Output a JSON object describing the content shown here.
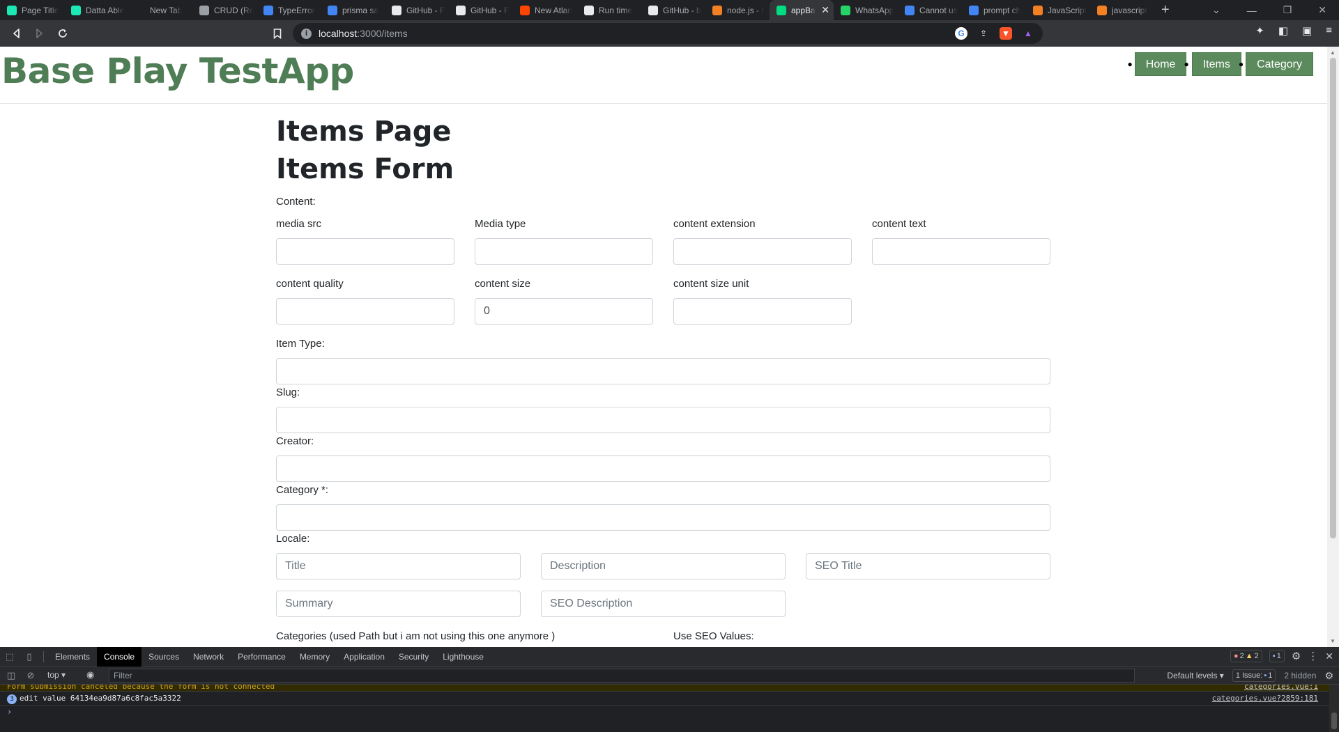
{
  "browser": {
    "tabs": [
      {
        "label": "Page Title",
        "color": "#1de9b6"
      },
      {
        "label": "Datta Able",
        "color": "#1de9b6"
      },
      {
        "label": "New Tab",
        "color": "#202124"
      },
      {
        "label": "CRUD (Re",
        "color": "#9aa0a6"
      },
      {
        "label": "TypeError",
        "color": "#4285f4"
      },
      {
        "label": "prisma sa",
        "color": "#4285f4"
      },
      {
        "label": "GitHub - F",
        "color": "#e8eaed"
      },
      {
        "label": "GitHub - F",
        "color": "#e8eaed"
      },
      {
        "label": "New Atlan",
        "color": "#ff4500"
      },
      {
        "label": "Run time",
        "color": "#e8eaed"
      },
      {
        "label": "GitHub - b",
        "color": "#e8eaed"
      },
      {
        "label": "node.js - I",
        "color": "#f48024"
      },
      {
        "label": "appBa",
        "color": "#00dc82",
        "active": true
      },
      {
        "label": "WhatsApp",
        "color": "#25d366"
      },
      {
        "label": "Cannot us",
        "color": "#4285f4"
      },
      {
        "label": "prompt ch",
        "color": "#4285f4"
      },
      {
        "label": "JavaScript",
        "color": "#f48024"
      },
      {
        "label": "javascript",
        "color": "#f48024"
      }
    ],
    "url_host": "localhost",
    "url_path": ":3000/items",
    "icons": {
      "back": "back-arrow-icon",
      "forward": "forward-arrow-icon",
      "reload": "reload-icon",
      "bookmark": "bookmark-icon"
    }
  },
  "header": {
    "brand": "Base Play TestApp",
    "nav": [
      {
        "label": "Home"
      },
      {
        "label": "Items"
      },
      {
        "label": "Category"
      }
    ]
  },
  "page": {
    "title": "Items Page",
    "form_title": "Items Form",
    "content_label": "Content:",
    "content_fields": [
      {
        "label": "media src",
        "value": ""
      },
      {
        "label": "Media type",
        "value": ""
      },
      {
        "label": "content extension",
        "value": ""
      },
      {
        "label": "content text",
        "value": ""
      },
      {
        "label": "content quality",
        "value": ""
      },
      {
        "label": "content size",
        "value": "0"
      },
      {
        "label": "content size unit",
        "value": ""
      }
    ],
    "item_type_label": "Item Type:",
    "slug_label": "Slug:",
    "creator_label": "Creator:",
    "category_label": "Category *:",
    "locale_label": "Locale:",
    "locale_fields": {
      "title_placeholder": "Title",
      "description_placeholder": "Description",
      "seo_title_placeholder": "SEO Title",
      "summary_placeholder": "Summary",
      "seo_description_placeholder": "SEO Description"
    },
    "categories_label": "Categories (used Path but i am not using this one anymore )",
    "use_seo_label": "Use SEO Values:"
  },
  "devtools": {
    "tabs": [
      "Elements",
      "Console",
      "Sources",
      "Network",
      "Performance",
      "Memory",
      "Application",
      "Security",
      "Lighthouse"
    ],
    "active_tab": "Console",
    "errors": "2",
    "warnings": "2",
    "messages": "1",
    "context": "top",
    "filter_placeholder": "Filter",
    "levels": "Default levels",
    "issues_label": "1 Issue:",
    "issues_count": "1",
    "hidden": "2 hidden",
    "warn_line": "Form submission canceled because the form is not connected",
    "warn_source": "categories.vue:1",
    "log_count": "3",
    "log_line": "edit value 64134ea9d87a6c8fac5a3322",
    "log_source": "categories.vue?2859:181"
  }
}
